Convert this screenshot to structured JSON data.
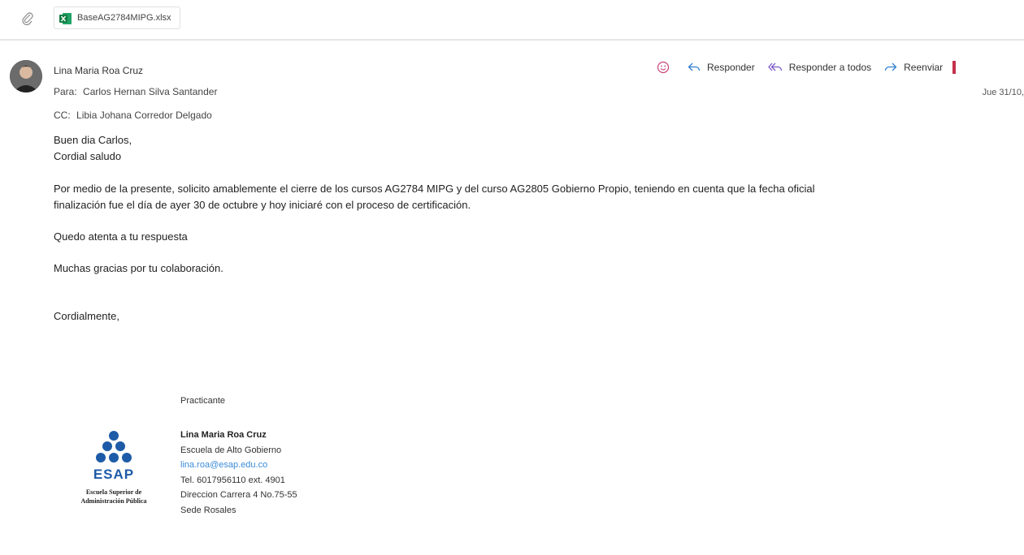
{
  "attachment": {
    "file_name": "BaseAG2784MIPG.xlsx"
  },
  "message": {
    "sender": "Lina Maria Roa Cruz",
    "to_label": "Para:",
    "to": "Carlos Hernan Silva Santander",
    "cc_label": "CC:",
    "cc": "Libia Johana Corredor Delgado",
    "date": "Jue 31/10,"
  },
  "actions": {
    "reply": "Responder",
    "reply_all": "Responder a todos",
    "forward": "Reenviar"
  },
  "body": {
    "greeting": "Buen dia Carlos,",
    "salutation": "Cordial saludo",
    "para1_line1": "Por medio de la presente, solicito amablemente el cierre de los cursos AG2784 MIPG y del curso AG2805 Gobierno Propio, teniendo en cuenta que la fecha oficial",
    "para1_line2": "finalización fue el día de ayer 30 de octubre y hoy iniciaré con el proceso de certificación.",
    "para2": "Quedo atenta a tu respuesta",
    "para3": "Muchas gracias por tu colaboración.",
    "closing": "Cordialmente,"
  },
  "signature": {
    "role": "Practicante",
    "name": "Lina Maria Roa Cruz",
    "org": "Escuela de Alto Gobierno",
    "email": "lina.roa@esap.edu.co",
    "phone": "Tel. 6017956110 ext. 4901",
    "address": "Direccion Carrera 4 No.75-55",
    "site": "Sede Rosales",
    "logo_text": "ESAP",
    "logo_caption_1": "Escuela Superior de",
    "logo_caption_2": "Administración Pública"
  },
  "colors": {
    "accent_blue": "#2f7fd1",
    "logo_blue": "#1d5ba8",
    "excel_green": "#107c41",
    "reply_all_purple": "#7a57c8"
  }
}
